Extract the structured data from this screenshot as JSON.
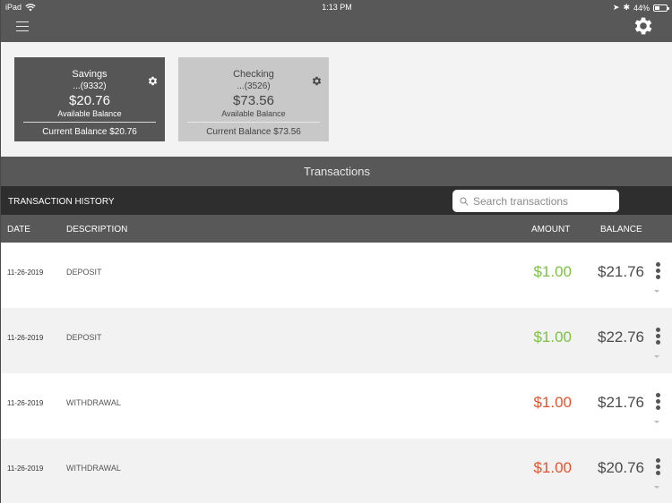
{
  "status_bar": {
    "device": "iPad",
    "time": "1:13 PM",
    "battery_percent": "44%",
    "battery_level": 0.44
  },
  "nav": {
    "menu_icon": "hamburger-menu-icon",
    "settings_icon": "gear-icon"
  },
  "accounts": [
    {
      "name": "Savings",
      "number": "...(9332)",
      "available_balance": "$20.76",
      "available_label": "Available Balance",
      "current_balance_text": "Current Balance $20.76",
      "selected": true
    },
    {
      "name": "Checking",
      "number": "...(3526)",
      "available_balance": "$73.56",
      "available_label": "Available Balance",
      "current_balance_text": "Current Balance $73.56",
      "selected": false
    }
  ],
  "transactions": {
    "title": "Transactions",
    "history_label": "TRANSACTION HISTORY",
    "search_placeholder": "Search transactions",
    "columns": {
      "date": "DATE",
      "description": "DESCRIPTION",
      "amount": "AMOUNT",
      "balance": "BALANCE"
    },
    "rows": [
      {
        "date": "11-26-2019",
        "description": "DEPOSIT",
        "amount": "$1.00",
        "type": "credit",
        "balance": "$21.76"
      },
      {
        "date": "11-26-2019",
        "description": "DEPOSIT",
        "amount": "$1.00",
        "type": "credit",
        "balance": "$22.76"
      },
      {
        "date": "11-26-2019",
        "description": "WITHDRAWAL",
        "amount": "$1.00",
        "type": "debit",
        "balance": "$21.76"
      },
      {
        "date": "11-26-2019",
        "description": "WITHDRAWAL",
        "amount": "$1.00",
        "type": "debit",
        "balance": "$20.76"
      }
    ]
  },
  "colors": {
    "credit": "#7dc142",
    "debit": "#e4532f",
    "header_bg": "#585858",
    "bar_bg": "#2e2e2e"
  }
}
